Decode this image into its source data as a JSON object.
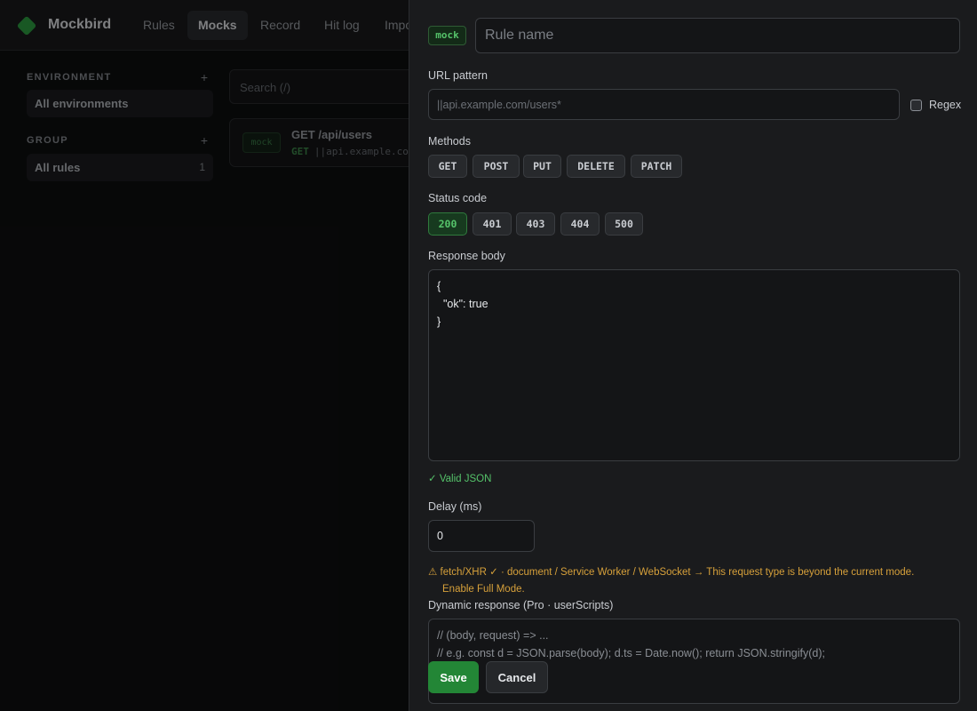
{
  "app": {
    "name": "Mockbird",
    "logo_icon": "green-diamond-logo",
    "brand_color": "#2ea043"
  },
  "nav": {
    "tabs": [
      {
        "label": "Rules"
      },
      {
        "label": "Mocks"
      },
      {
        "label": "Record"
      },
      {
        "label": "Hit log"
      },
      {
        "label": "Impo"
      }
    ],
    "active": "Mocks"
  },
  "sidebar": {
    "environment": {
      "heading": "ENVIRONMENT",
      "add_icon": "+",
      "item": "All environments"
    },
    "group": {
      "heading": "GROUP",
      "add_icon": "+",
      "item": "All rules",
      "count": "1"
    }
  },
  "search": {
    "placeholder": "Search  (/)"
  },
  "rule_list": [
    {
      "badge": "mock",
      "title": "GET /api/users",
      "method": "GET",
      "pattern": "||api.example.co"
    }
  ],
  "editor": {
    "badge": "mock",
    "name_placeholder": "Rule name",
    "url_label": "URL pattern",
    "url_placeholder": "||api.example.com/users*",
    "regex_label": "Regex",
    "regex_checked": false,
    "methods_label": "Methods",
    "methods": [
      "GET",
      "POST",
      "PUT",
      "DELETE",
      "PATCH"
    ],
    "status_label": "Status code",
    "status_codes": [
      "200",
      "401",
      "403",
      "404",
      "500"
    ],
    "status_selected": "200",
    "body_label": "Response body",
    "body_value": "{\n  \"ok\": true\n}",
    "valid_text": "✓ Valid JSON",
    "delay_label": "Delay (ms)",
    "delay_value": "0",
    "warning_line1": "⚠  fetch/XHR ✓ · document / Service Worker / WebSocket → This request type is beyond the current mode.",
    "warning_line2": "Enable Full Mode.",
    "dynamic_label": "Dynamic response (Pro · userScripts)",
    "dynamic_placeholder": "// (body, request) => ...\n// e.g. const d = JSON.parse(body); d.ts = Date.now(); return JSON.stringify(d);",
    "save_label": "Save",
    "cancel_label": "Cancel"
  }
}
